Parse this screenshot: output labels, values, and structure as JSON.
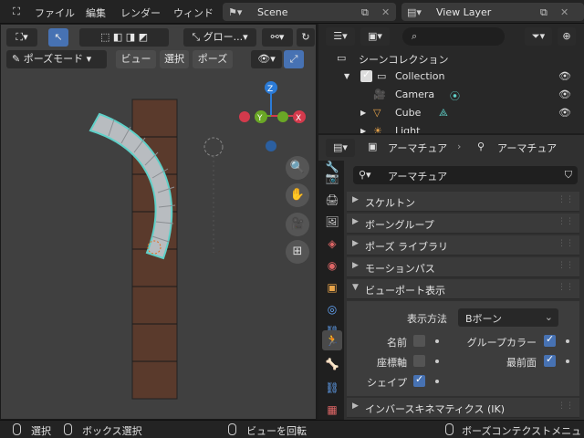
{
  "topbar": {
    "menu": [
      "ファイル",
      "編集",
      "レンダー",
      "ウィンド"
    ],
    "scene_label": "Scene",
    "view_layer_label": "View Layer"
  },
  "viewport": {
    "mode_label": "ポーズモード",
    "menu": [
      "ビュー",
      "選択",
      "ポーズ"
    ],
    "transform_orientation": "グロー...",
    "gizmo": {
      "z": "Z",
      "y": "Y",
      "x": "X"
    },
    "colors": {
      "z": "#2b7bd7",
      "y": "#6aa726",
      "x": "#d33a4c",
      "bone_outline": "#5fd0c8",
      "bone_fill": "#b8bcc0",
      "bar": "#5a3a2c"
    }
  },
  "outliner": {
    "search_placeholder": "",
    "scene_collection": "シーンコレクション",
    "items": [
      {
        "label": "Collection"
      },
      {
        "label": "Camera"
      },
      {
        "label": "Cube"
      },
      {
        "label": "Light"
      }
    ]
  },
  "properties": {
    "breadcrumb": [
      "アーマチュア",
      "アーマチュア"
    ],
    "name_field": "アーマチュア",
    "panels": [
      {
        "label": "スケルトン",
        "expanded": false
      },
      {
        "label": "ボーングループ",
        "expanded": false
      },
      {
        "label": "ポーズ ライブラリ",
        "expanded": false
      },
      {
        "label": "モーションパス",
        "expanded": false
      },
      {
        "label": "ビューポート表示",
        "expanded": true
      }
    ],
    "display": {
      "method_label": "表示方法",
      "method_value": "Bボーン",
      "names_label": "名前",
      "names_checked": false,
      "group_colors_label": "グループカラー",
      "group_colors_checked": true,
      "axes_label": "座標軸",
      "axes_checked": false,
      "in_front_label": "最前面",
      "in_front_checked": true,
      "shapes_label": "シェイプ",
      "shapes_checked": true
    },
    "ik_panel": "インバースキネマティクス (IK)"
  },
  "statusbar": {
    "select": "選択",
    "box_select": "ボックス選択",
    "rotate_view": "ビューを回転",
    "context_menu": "ボーズコンテクストメニュ"
  }
}
